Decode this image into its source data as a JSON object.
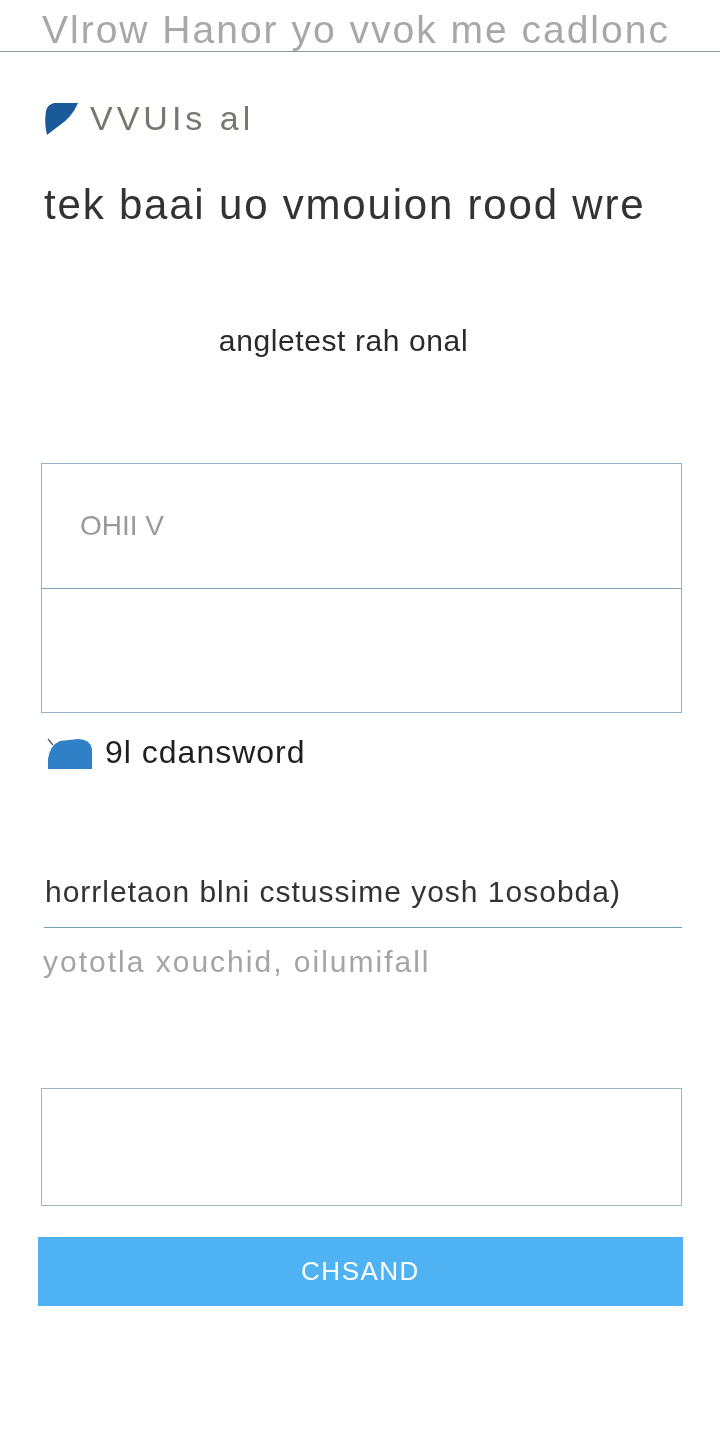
{
  "header": {
    "title": "Vlrow Hanor yo vvok me cadlonc"
  },
  "brand": {
    "label": "VVUIs al"
  },
  "headline": "tek baai uo vmouion rood wre",
  "subtitle": "angletest rah onal",
  "login_box": {
    "fields": [
      {
        "kind": "input",
        "placeholder": "OHII V"
      },
      {
        "kind": "input"
      }
    ]
  },
  "option": {
    "label": "9l cdansword"
  },
  "message_field": {
    "value": "horrletaon blni cstussime yosh 1osobda)",
    "hint": "yototla xouchid, oilumifall"
  },
  "comment_box": {
    "kind": "textarea"
  },
  "submit_button": {
    "label": "CHSAND"
  }
}
